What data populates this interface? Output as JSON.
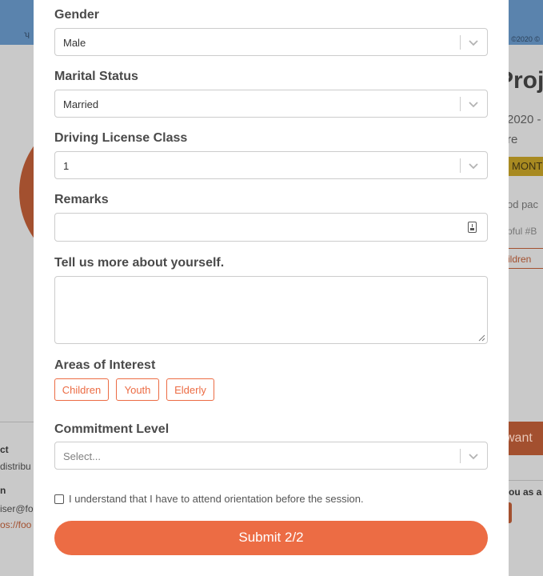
{
  "background": {
    "copyright_text": "©2020 ©",
    "project_title": "Proj",
    "date_text": "2020 -",
    "sub_text": "re",
    "badge_text": "MONT",
    "text_line1": "od pac",
    "text_line2": "pful #B",
    "tag_text": "ildren",
    "want_button": "want",
    "join_text": "ou as a",
    "left_heading1": "ct",
    "left_text1": "distribu",
    "left_heading2": "n",
    "left_text2": "iser@fo",
    "left_link": "os://foo",
    "colors": {
      "banner": "#5a83ad",
      "accent": "#a3502f",
      "badge": "#a88a21"
    }
  },
  "form": {
    "gender": {
      "label": "Gender",
      "value": "Male"
    },
    "marital_status": {
      "label": "Marital Status",
      "value": "Married"
    },
    "driving_license": {
      "label": "Driving License Class",
      "value": "1"
    },
    "remarks": {
      "label": "Remarks",
      "value": "",
      "icon": "keyboard-icon"
    },
    "about": {
      "label": "Tell us more about yourself.",
      "value": ""
    },
    "areas_of_interest": {
      "label": "Areas of Interest",
      "options": [
        "Children",
        "Youth",
        "Elderly"
      ]
    },
    "commitment_level": {
      "label": "Commitment Level",
      "placeholder": "Select..."
    },
    "orientation": {
      "label": "I understand that I have to attend orientation before the session.",
      "checked": false
    },
    "submit_label": "Submit 2/2"
  },
  "colors": {
    "accent": "#ec6c44",
    "label_text": "#4a4a4a",
    "border": "#cccccc"
  }
}
